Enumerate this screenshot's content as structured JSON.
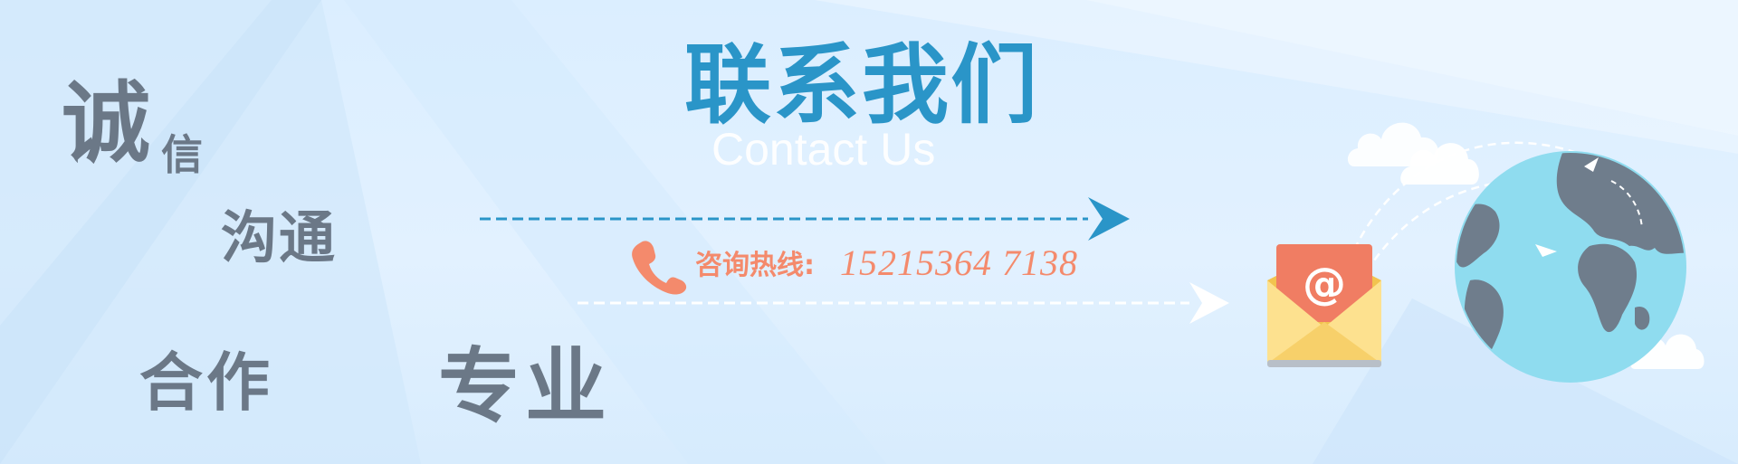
{
  "words": {
    "cheng": "诚",
    "xin": "信",
    "goutong": "沟通",
    "hezuo": "合作",
    "zhuanye": "专业"
  },
  "title": "联系我们",
  "subtitle": "Contact Us",
  "hotline": {
    "label": "咨询热线:",
    "number": "15215364 7138"
  },
  "icons": {
    "phone": "phone-icon",
    "email": "email-at-icon",
    "globe": "globe-icon"
  },
  "colors": {
    "title": "#2a95c8",
    "hotline": "#f48a6c",
    "words": "#6b7887",
    "envelope_flap": "#f07d63",
    "globe_ocean": "#8fdcef",
    "globe_land": "#6f7d8c"
  }
}
